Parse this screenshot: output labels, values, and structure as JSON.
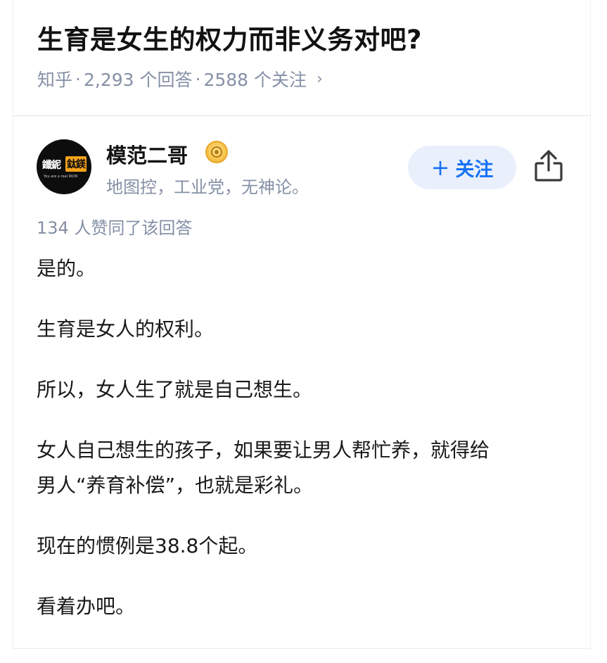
{
  "question": {
    "title": "生育是女生的权力而非义务对吧?",
    "source": "知乎",
    "answer_count": "2,293 个回答",
    "follower_count": "2588 个关注",
    "separator": "·",
    "chevron": "›"
  },
  "author": {
    "avatar_left_text": "鑯鈮",
    "avatar_right_text": "鈦鎂",
    "avatar_tagline": "You are a real IRON",
    "name": "模范二哥",
    "badge_icon": "medal-icon",
    "bio": "地图控，工业党，无神论。"
  },
  "actions": {
    "follow_plus": "+",
    "follow_label": "关注",
    "share_icon": "share-icon"
  },
  "answer": {
    "votes": "134 人赞同了该回答",
    "paragraphs": [
      "是的。",
      "生育是女人的权利。",
      "所以，女人生了就是自己想生。",
      "女人自己想生的孩子，如果要让男人帮忙养，就得给",
      "男人“养育补偿”，也就是彩礼。",
      "现在的惯例是38.8个起。",
      "看着办吧。"
    ]
  },
  "colors": {
    "accent": "#1772f6",
    "follow_bg": "#e9f0fb",
    "meta_gray": "#8590a6",
    "text": "#191919",
    "avatar_orange": "#f5a21b"
  }
}
